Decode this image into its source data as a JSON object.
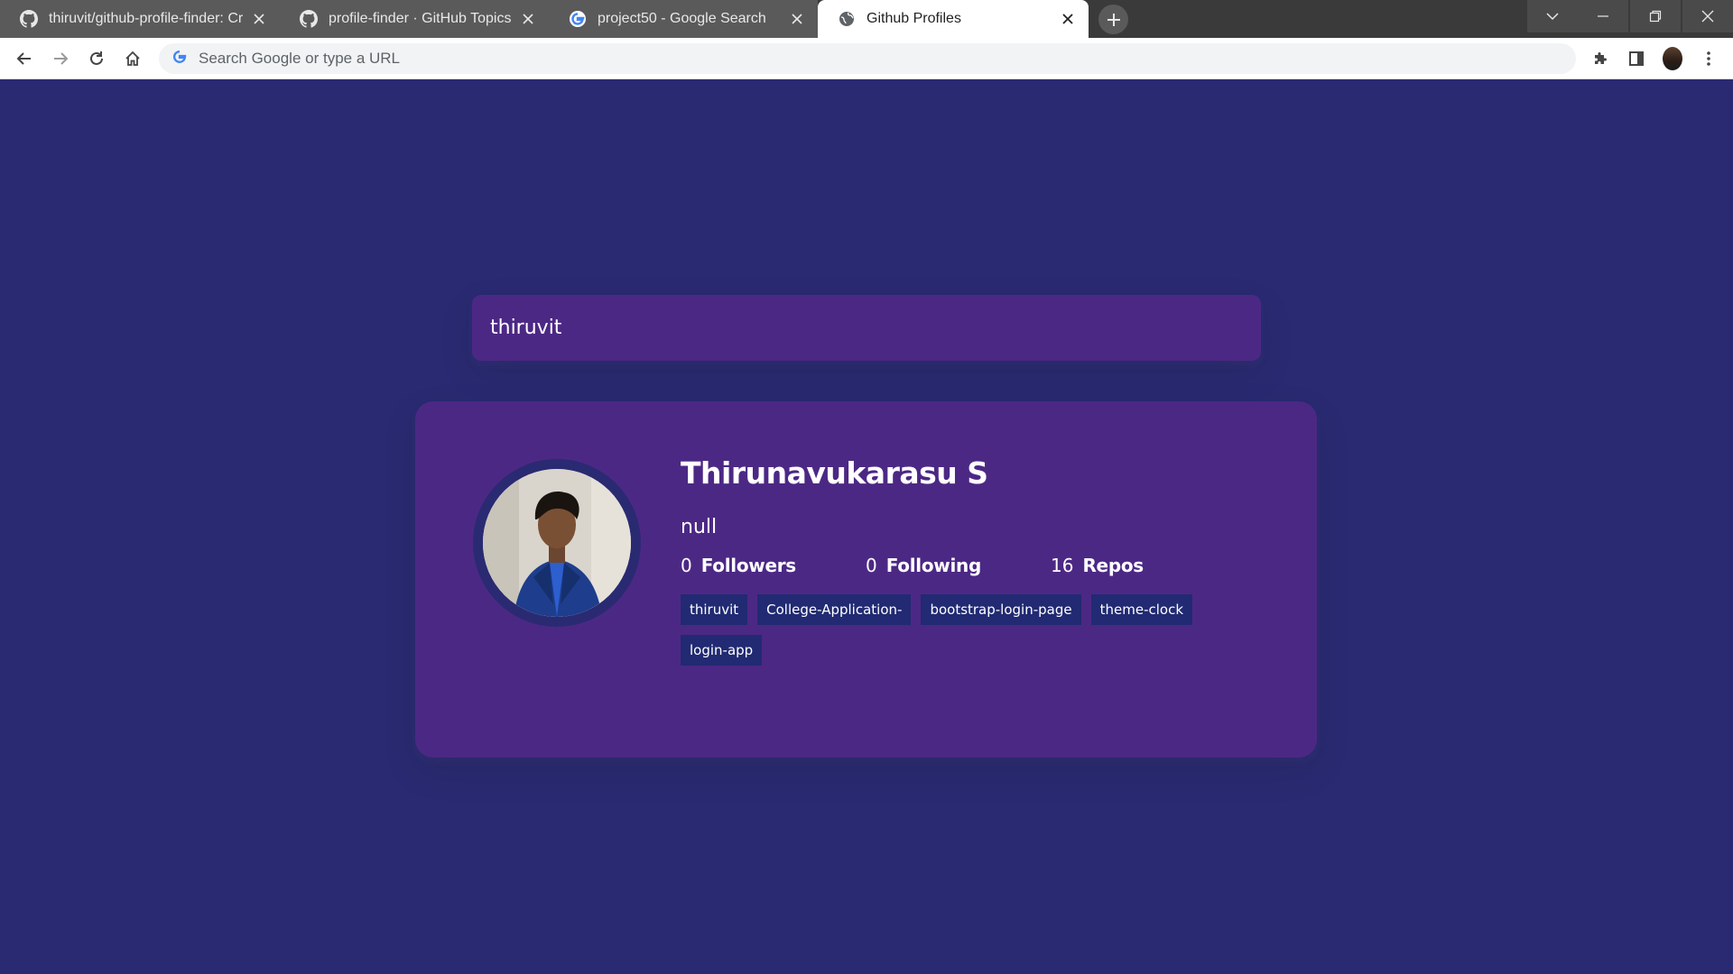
{
  "browser": {
    "tabs": [
      {
        "title": "thiruvit/github-profile-finder: Cr",
        "favicon": "github-icon"
      },
      {
        "title": "profile-finder · GitHub Topics",
        "favicon": "github-icon"
      },
      {
        "title": "project50 - Google Search",
        "favicon": "google-icon"
      },
      {
        "title": "Github Profiles",
        "favicon": "globe-icon"
      }
    ],
    "omnibox_placeholder": "Search Google or type a URL"
  },
  "search": {
    "value": "thiruvit"
  },
  "profile": {
    "name": "Thirunavukarasu S",
    "bio": "null",
    "stats": {
      "followers": {
        "value": "0",
        "label": "Followers"
      },
      "following": {
        "value": "0",
        "label": "Following"
      },
      "repos": {
        "value": "16",
        "label": "Repos"
      }
    },
    "repos": [
      "thiruvit",
      "College-Application-",
      "bootstrap-login-page",
      "theme-clock",
      "login-app"
    ]
  },
  "colors": {
    "background": "#2a2a72",
    "card": "#4c2885",
    "repo_tag": "#212a72"
  }
}
